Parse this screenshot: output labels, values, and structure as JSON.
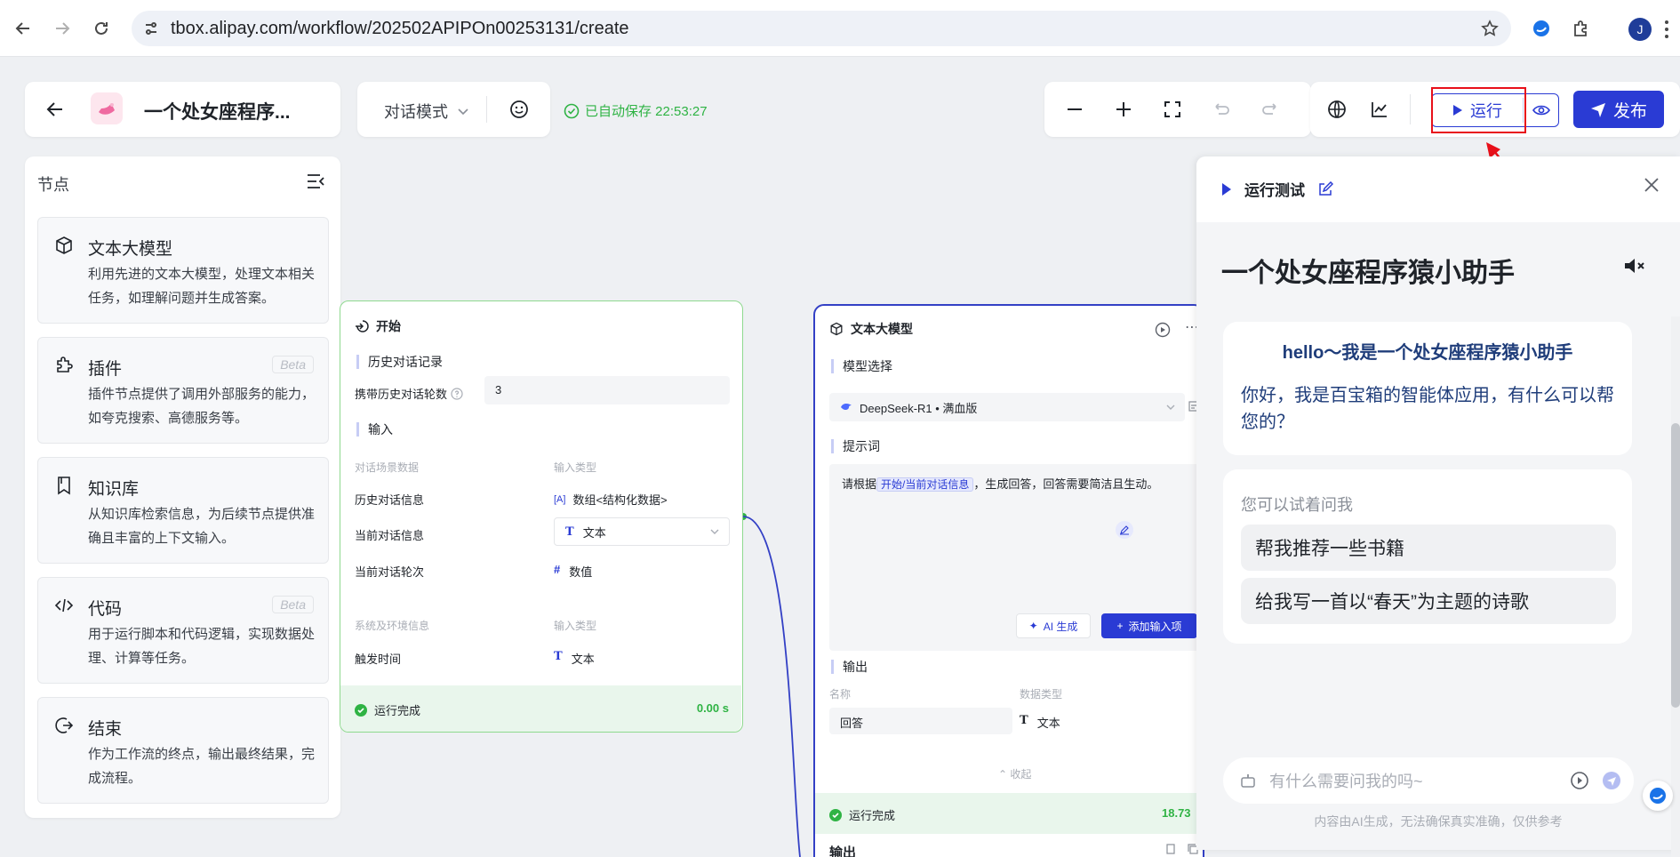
{
  "browser": {
    "url": "tbox.alipay.com/workflow/202502APIPOn00253131/create",
    "avatar_letter": "J"
  },
  "header": {
    "app_title": "一个处女座程序...",
    "mode": "对话模式",
    "autosave": "已自动保存 22:53:27",
    "run_label": "运行",
    "publish_label": "发布"
  },
  "left_panel": {
    "title": "节点",
    "items": [
      {
        "title": "文本大模型",
        "desc": "利用先进的文本大模型，处理文本相关任务，如理解问题并生成答案。",
        "beta": ""
      },
      {
        "title": "插件",
        "desc": "插件节点提供了调用外部服务的能力，如夸克搜索、高德服务等。",
        "beta": "Beta"
      },
      {
        "title": "知识库",
        "desc": "从知识库检索信息，为后续节点提供准确且丰富的上下文输入。",
        "beta": ""
      },
      {
        "title": "代码",
        "desc": "用于运行脚本和代码逻辑，实现数据处理、计算等任务。",
        "beta": "Beta"
      },
      {
        "title": "结束",
        "desc": "作为工作流的终点，输出最终结果，完成流程。",
        "beta": ""
      }
    ]
  },
  "start_node": {
    "title": "开始",
    "history_section": "历史对话记录",
    "history_rounds_label": "携带历史对话轮数",
    "history_rounds_value": "3",
    "input_section": "输入",
    "col_data": "对话场景数据",
    "col_type": "输入类型",
    "rows": [
      {
        "name": "历史对话信息",
        "type": "数组<结构化数据>"
      },
      {
        "name": "当前对话信息",
        "type": "文本"
      },
      {
        "name": "当前对话轮次",
        "type": "数值"
      }
    ],
    "sys_col_data": "系统及环境信息",
    "sys_col_type": "输入类型",
    "sys_rows": [
      {
        "name": "触发时间",
        "type": "文本"
      }
    ],
    "status": "运行完成",
    "time": "0.00 s"
  },
  "llm_node": {
    "title": "文本大模型",
    "model_section": "模型选择",
    "model": "DeepSeek-R1 • 满血版",
    "prompt_section": "提示词",
    "prompt_pre": "请根据",
    "prompt_tag": "开始/当前对话信息",
    "prompt_post": "，生成回答，回答需要简洁且生动。",
    "ai_gen": "AI 生成",
    "add_input": "添加输入项",
    "output_section": "输出",
    "col_name": "名称",
    "col_type": "数据类型",
    "out_name": "回答",
    "out_type": "文本",
    "collapse": "收起",
    "status": "运行完成",
    "time": "18.73",
    "output2": "输出"
  },
  "chat": {
    "header": "运行测试",
    "bot_name": "一个处女座程序猿小助手",
    "greeting_title": "hello～我是一个处女座程序猿小助手",
    "greeting_body": "你好，我是百宝箱的智能体应用，有什么可以帮您的？",
    "suggest_title": "您可以试着问我",
    "suggestions": [
      "帮我推荐一些书籍",
      "给我写一首以“春天”为主题的诗歌"
    ],
    "input_placeholder": "有什么需要问我的吗~",
    "disclaimer": "内容由AI生成，无法确保真实准确，仅供参考"
  },
  "colors": {
    "primary": "#2a3bd4",
    "success": "#2fb344",
    "annotation": "#e8101a"
  }
}
